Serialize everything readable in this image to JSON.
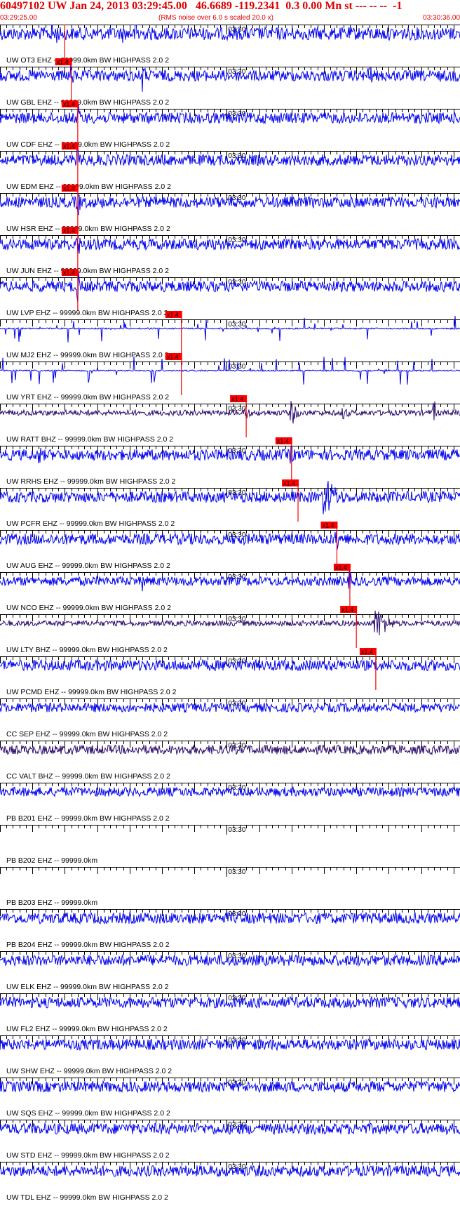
{
  "header": {
    "title": "60497102 UW Jan 24, 2013 03:29:45.00   46.6689 -119.2341  0.3 0.00 Mn st --- -- --  -1",
    "start_time": "03:29:25.00",
    "note": "(RMS noise over 6.0 s scaled 20.0 x)",
    "end_time": "03:30:36.00"
  },
  "colors": {
    "trace": "#0000ee",
    "trace_dark": "#2a0a6a",
    "pick": "#ff0000",
    "axis": "#000000",
    "text": "#000000"
  },
  "chart_data": {
    "type": "line",
    "title": "60497102 UW Jan 24, 2013 03:29:45.00",
    "x_range": [
      "03:29:25.00",
      "03:30:36.00"
    ],
    "minute_mark_label": "03:30",
    "pick_label": "x1.4",
    "series": [
      {
        "name": "UW OT3 EHZ -- 99999.0km BW  HIGHPASS  2.0  2",
        "pick": "03:29:35",
        "amp": 0.35,
        "dark": false,
        "events": [
          {
            "t": "03:29:33",
            "a": 1.0,
            "w": 3
          },
          {
            "t": "03:29:44",
            "a": 0.6,
            "w": 1
          },
          {
            "t": "03:29:46",
            "a": 1.1,
            "w": 2
          }
        ]
      },
      {
        "name": "UW GBL EHZ -- 99999.0km BW  HIGHPASS  2.0  2",
        "pick": "03:29:36",
        "amp": 0.3,
        "dark": false,
        "events": [
          {
            "t": "03:29:36",
            "a": 1.0,
            "w": 1
          },
          {
            "t": "03:29:47",
            "a": 1.1,
            "w": 1
          },
          {
            "t": "03:30:22",
            "a": 1.0,
            "w": 1
          }
        ]
      },
      {
        "name": "UW CDF EHZ -- 99999.0km BW  HIGHPASS  2.0  2",
        "pick": "03:29:37",
        "amp": 0.3,
        "dark": false,
        "events": [
          {
            "t": "03:29:37",
            "a": 1.0,
            "w": 1
          }
        ]
      },
      {
        "name": "UW EDM EHZ -- 99999.0km BW  HIGHPASS  2.0  2",
        "pick": "03:29:37",
        "amp": 0.3,
        "dark": false,
        "events": [
          {
            "t": "03:29:37",
            "a": 1.0,
            "w": 1
          }
        ]
      },
      {
        "name": "UW HSR EHZ -- 99999.0km BW  HIGHPASS  2.0  2",
        "pick": "03:29:37",
        "amp": 0.3,
        "dark": false,
        "events": [
          {
            "t": "03:29:37",
            "a": 1.0,
            "w": 1
          }
        ]
      },
      {
        "name": "UW JUN EHZ -- 99999.0km BW  HIGHPASS  2.0  2",
        "pick": "03:29:37",
        "amp": 0.3,
        "dark": false,
        "events": [
          {
            "t": "03:29:37",
            "a": 1.0,
            "w": 1
          }
        ]
      },
      {
        "name": "UW LVP EHZ -- 99999.0km BW  HIGHPASS  2.0  2",
        "pick": "03:29:37",
        "amp": 0.3,
        "dark": false,
        "events": [
          {
            "t": "03:29:37",
            "a": 1.1,
            "w": 1
          }
        ]
      },
      {
        "name": "UW MJ2 EHZ -- 99999.0km BW  HIGHPASS  2.0  2",
        "pick": "03:29:53",
        "amp": 0.12,
        "dark": false,
        "spiky": true,
        "events": []
      },
      {
        "name": "UW YRT EHZ -- 99999.0km BW  HIGHPASS  2.0  2",
        "pick": "03:29:53",
        "amp": 0.12,
        "dark": false,
        "spiky": true,
        "events": []
      },
      {
        "name": "UW RATT BHZ -- 99999.0km BW  HIGHPASS  2.0  2",
        "pick": "03:30:03",
        "amp": 0.15,
        "dark": true,
        "events": [
          {
            "t": "03:30:03",
            "a": 0.7,
            "w": 1
          },
          {
            "t": "03:30:10",
            "a": 0.8,
            "w": 2
          },
          {
            "t": "03:30:18",
            "a": 0.5,
            "w": 2
          },
          {
            "t": "03:30:32",
            "a": 0.8,
            "w": 1
          }
        ]
      },
      {
        "name": "UW RRHS EHZ -- 99999.0km BW  HIGHPASS  2.0  2",
        "pick": "03:30:10",
        "amp": 0.3,
        "dark": false,
        "events": [
          {
            "t": "03:29:31",
            "a": 0.8,
            "w": 1
          },
          {
            "t": "03:30:10",
            "a": 0.9,
            "w": 1
          }
        ]
      },
      {
        "name": "UW PCFR EHZ -- 99999.0km BW  HIGHPASS  2.0  2",
        "pick": "03:30:11",
        "amp": 0.3,
        "dark": false,
        "events": [
          {
            "t": "03:30:15",
            "a": 1.3,
            "w": 5
          }
        ]
      },
      {
        "name": "UW AUG EHZ -- 99999.0km BW  HIGHPASS  2.0  2",
        "pick": "03:30:17",
        "amp": 0.3,
        "dark": false,
        "events": [
          {
            "t": "03:30:17",
            "a": 1.0,
            "w": 1
          }
        ]
      },
      {
        "name": "UW NCO EHZ -- 99999.0km BW  HIGHPASS  2.0  2",
        "pick": "03:30:19",
        "amp": 0.25,
        "dark": false,
        "events": [
          {
            "t": "03:29:47",
            "a": 0.6,
            "w": 2
          },
          {
            "t": "03:30:19",
            "a": 0.8,
            "w": 1
          }
        ]
      },
      {
        "name": "UW LTY BHZ -- 99999.0km BW  HIGHPASS  2.0  2",
        "pick": "03:30:20",
        "amp": 0.15,
        "dark": true,
        "events": [
          {
            "t": "03:30:23",
            "a": 1.1,
            "w": 4
          }
        ]
      },
      {
        "name": "UW PCMD EHZ -- 99999.0km BW  HIGHPASS  2.0  2",
        "pick": "03:30:23",
        "amp": 0.3,
        "dark": false,
        "events": [
          {
            "t": "03:30:23",
            "a": 0.6,
            "w": 1
          }
        ]
      },
      {
        "name": "CC SEP EHZ -- 99999.0km BW  HIGHPASS  2.0  2",
        "pick": null,
        "amp": 0.25,
        "dark": false,
        "events": []
      },
      {
        "name": "CC VALT BHZ -- 99999.0km BW  HIGHPASS  2.0  2",
        "pick": null,
        "amp": 0.25,
        "dark": true,
        "events": []
      },
      {
        "name": "PB B201 EHZ -- 99999.0km BW  HIGHPASS  2.0  2",
        "pick": null,
        "amp": 0.25,
        "dark": false,
        "events": []
      },
      {
        "name": "PB B202 EHZ -- 99999.0km",
        "pick": null,
        "amp": 0,
        "dark": false,
        "flat": true,
        "events": []
      },
      {
        "name": "PB B203 EHZ -- 99999.0km",
        "pick": null,
        "amp": 0,
        "dark": false,
        "flat": true,
        "events": []
      },
      {
        "name": "PB B204 EHZ -- 99999.0km BW  HIGHPASS  2.0  2",
        "pick": null,
        "amp": 0.3,
        "dark": false,
        "events": []
      },
      {
        "name": "UW ELK EHZ -- 99999.0km BW  HIGHPASS  2.0  2",
        "pick": null,
        "amp": 0.3,
        "dark": false,
        "events": []
      },
      {
        "name": "UW FL2 EHZ -- 99999.0km BW  HIGHPASS  2.0  2",
        "pick": null,
        "amp": 0.3,
        "dark": false,
        "events": []
      },
      {
        "name": "UW SHW EHZ -- 99999.0km BW  HIGHPASS  2.0  2",
        "pick": null,
        "amp": 0.3,
        "dark": false,
        "events": []
      },
      {
        "name": "UW SQS EHZ -- 99999.0km BW  HIGHPASS  2.0  2",
        "pick": null,
        "amp": 0.3,
        "dark": false,
        "events": []
      },
      {
        "name": "UW STD EHZ -- 99999.0km BW  HIGHPASS  2.0  2",
        "pick": null,
        "amp": 0.3,
        "dark": false,
        "events": []
      },
      {
        "name": "UW TDL EHZ -- 99999.0km BW  HIGHPASS  2.0  2",
        "pick": null,
        "amp": 0.3,
        "dark": false,
        "events": []
      }
    ]
  }
}
